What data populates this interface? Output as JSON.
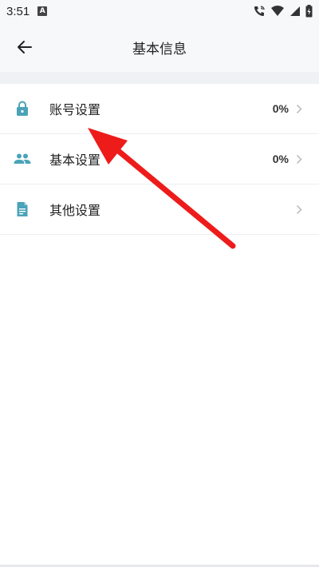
{
  "status_bar": {
    "time": "3:51",
    "icons": [
      "a-icon",
      "call-icon",
      "wifi-icon",
      "signal-icon",
      "battery-charging-icon"
    ]
  },
  "header": {
    "title": "基本信息",
    "back_icon": "arrow-left-icon"
  },
  "list": {
    "items": [
      {
        "label": "账号设置",
        "value": "0%",
        "icon": "lock-icon"
      },
      {
        "label": "基本设置",
        "value": "0%",
        "icon": "people-icon"
      },
      {
        "label": "其他设置",
        "value": "",
        "icon": "document-icon"
      }
    ]
  },
  "colors": {
    "accent": "#4aa3b8",
    "annotation_arrow": "#ee1b1b",
    "background": "#f7f8fa"
  }
}
